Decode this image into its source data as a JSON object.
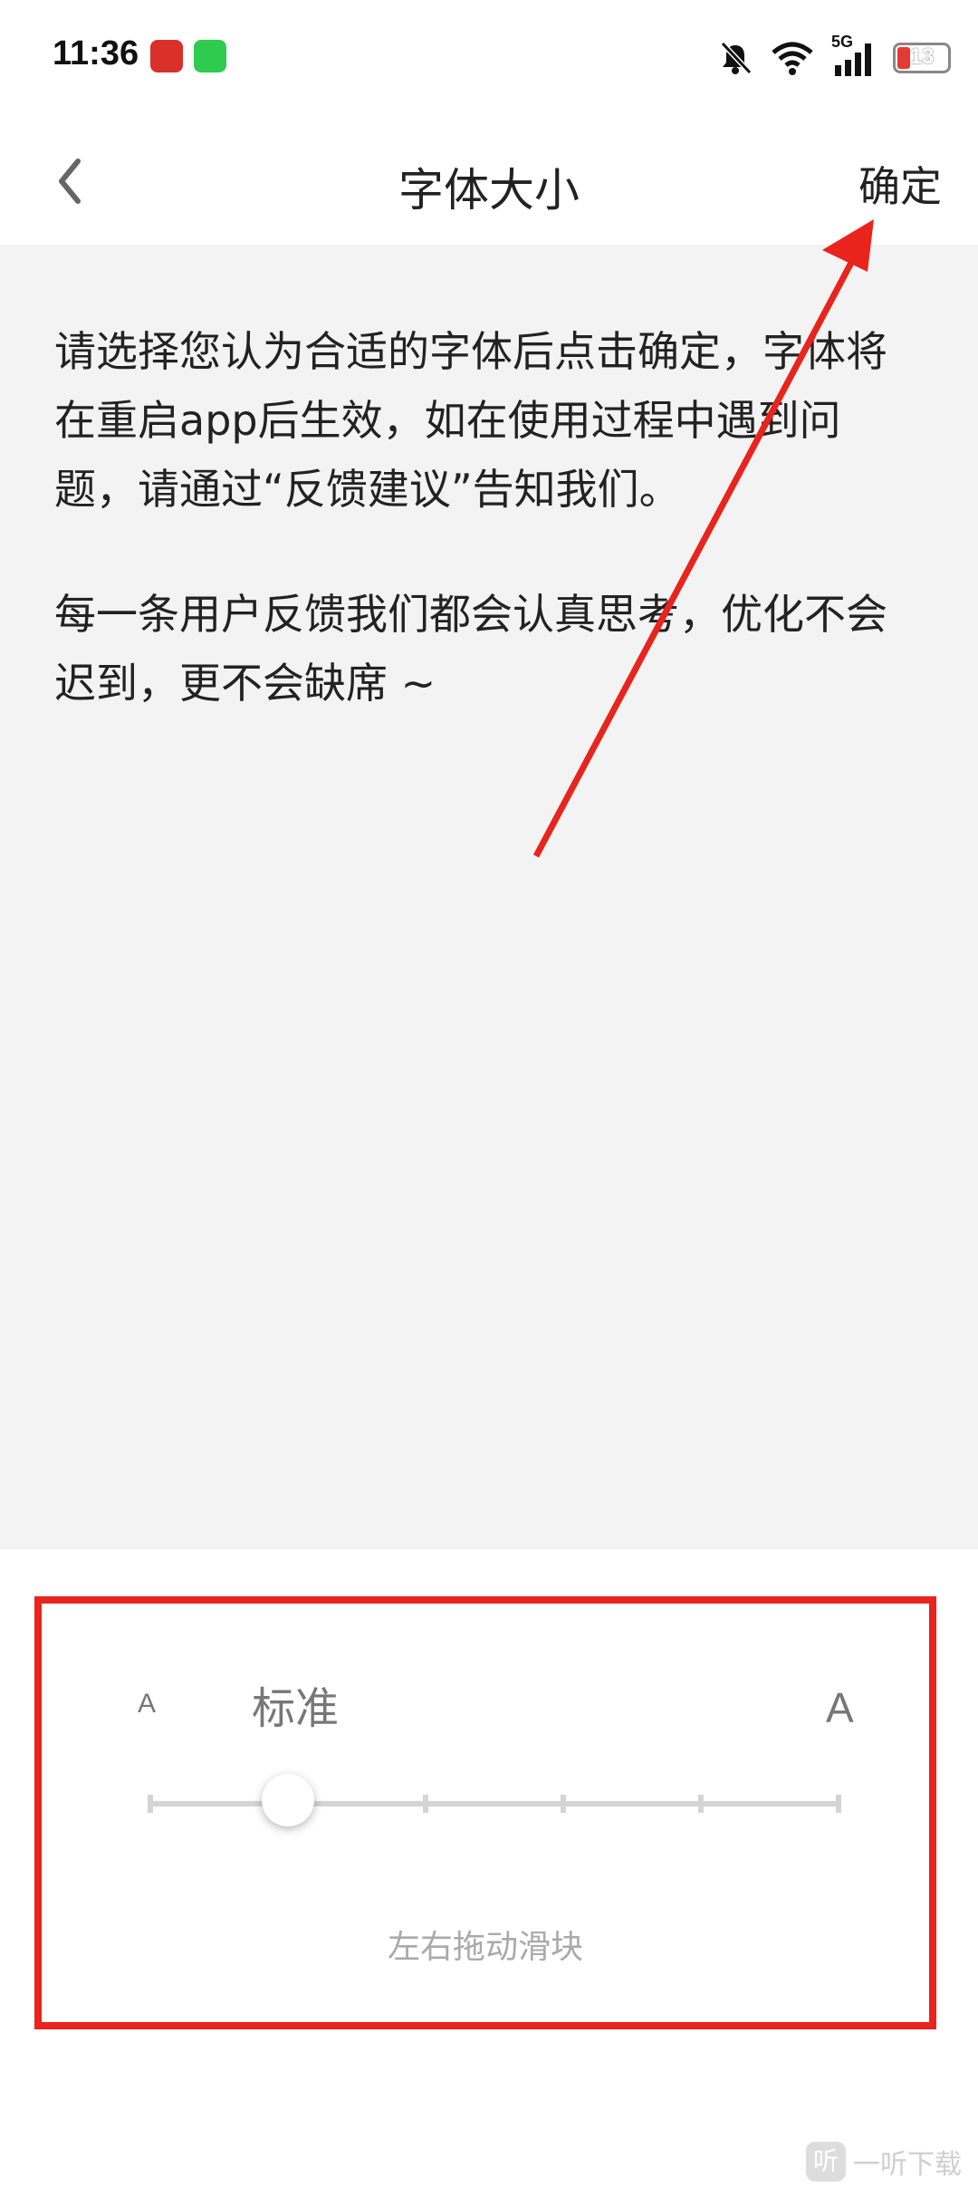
{
  "status_bar": {
    "time": "11:36",
    "network": "5G",
    "battery": "13",
    "icons": [
      "app-icon-red",
      "phone-icon",
      "mute-bell-icon",
      "wifi-icon",
      "signal-icon",
      "battery-icon"
    ]
  },
  "header": {
    "title": "字体大小",
    "confirm_label": "确定",
    "back_icon": "chevron-left-icon"
  },
  "content": {
    "paragraph_1": "请选择您认为合适的字体后点击确定，字体将在重启app后生效，如在使用过程中遇到问题，请通过“反馈建议”告知我们。",
    "paragraph_2": "每一条用户反馈我们都会认真思考，优化不会迟到，更不会缺席 ~"
  },
  "font_slider": {
    "small_label": "A",
    "large_label": "A",
    "current_level_label": "标准",
    "hint": "左右拖动滑块",
    "steps": 6,
    "selected_index": 1
  },
  "watermark": {
    "logo_text": "听",
    "text": "一听下载"
  },
  "colors": {
    "annotation_red": "#e8241c",
    "content_background": "#f3f3f3"
  }
}
